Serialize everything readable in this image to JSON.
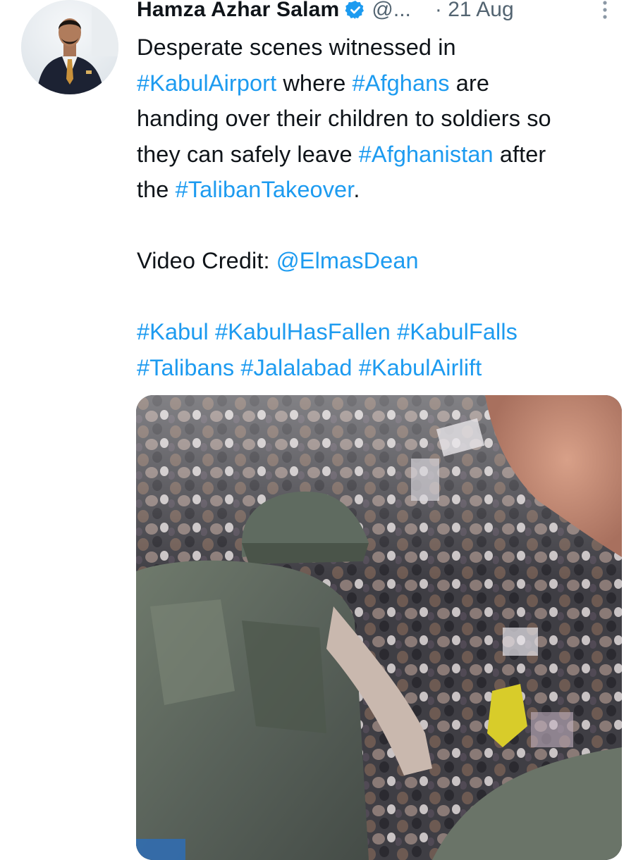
{
  "tweet": {
    "author": {
      "display_name": "Hamza Azhar Salam",
      "handle": "@...",
      "verified": true
    },
    "separator": "·",
    "date": "21 Aug",
    "text": {
      "line1": "Desperate scenes witnessed in",
      "line2_tag1": "#KabulAirport",
      "line2_mid": " where ",
      "line2_tag2": "#Afghans",
      "line2_end": " are",
      "line3": "handing over their children to soldiers so",
      "line4_start": "they can safely leave ",
      "line4_tag": "#Afghanistan",
      "line4_end": " after",
      "line5_start": "the ",
      "line5_tag": "#TalibanTakeover",
      "line5_end": ".",
      "credit_label": "Video Credit: ",
      "credit_mention": "@ElmasDean",
      "tags_row1": [
        "#Kabul",
        "#KabulHasFallen",
        "#KabulFalls"
      ],
      "tags_row2": [
        "#Talibans",
        "#Jalalabad",
        "#KabulAirlift"
      ]
    },
    "media": {
      "type": "video-thumbnail",
      "description_icon": "video-still"
    },
    "icons": {
      "verified": "verified-badge-icon",
      "more": "more-options-icon"
    },
    "colors": {
      "link": "#1d9bf0",
      "text": "#0f1419",
      "secondary": "#536471"
    }
  }
}
